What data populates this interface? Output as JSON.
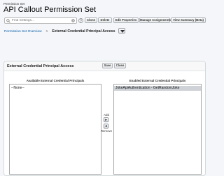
{
  "header": {
    "eyebrow": "Permission Set",
    "title": "API Callout Permission Set"
  },
  "toolbar": {
    "search_placeholder": "Find Settings...",
    "buttons": [
      "Clone",
      "Delete",
      "Edit Properties",
      "Manage Assignments",
      "View Summary (Beta)"
    ]
  },
  "breadcrumb": {
    "link": "Permission Set Overview",
    "separator": ">",
    "current": "External Credential Principal Access"
  },
  "panel": {
    "title": "External Credential Principal Access",
    "save_label": "Save",
    "close_label": "Close",
    "available": {
      "label": "Available External Credential Principals",
      "options": [
        "--None--"
      ]
    },
    "enabled": {
      "label": "Enabled External Credential Principals",
      "options": [
        "JokeApiAuthentication - GetRandomJoke"
      ]
    },
    "add_label": "Add",
    "remove_label": "Remove"
  },
  "colors": {
    "page_bg": "#f4f6f9",
    "link": "#015ba7",
    "selected_option_bg": "#cfd3d8",
    "button_border": "#aeb4bb"
  },
  "icons": [
    "search-icon",
    "clear-icon",
    "help-icon",
    "chevron-down-icon",
    "arrow-right-icon",
    "arrow-left-icon"
  ]
}
